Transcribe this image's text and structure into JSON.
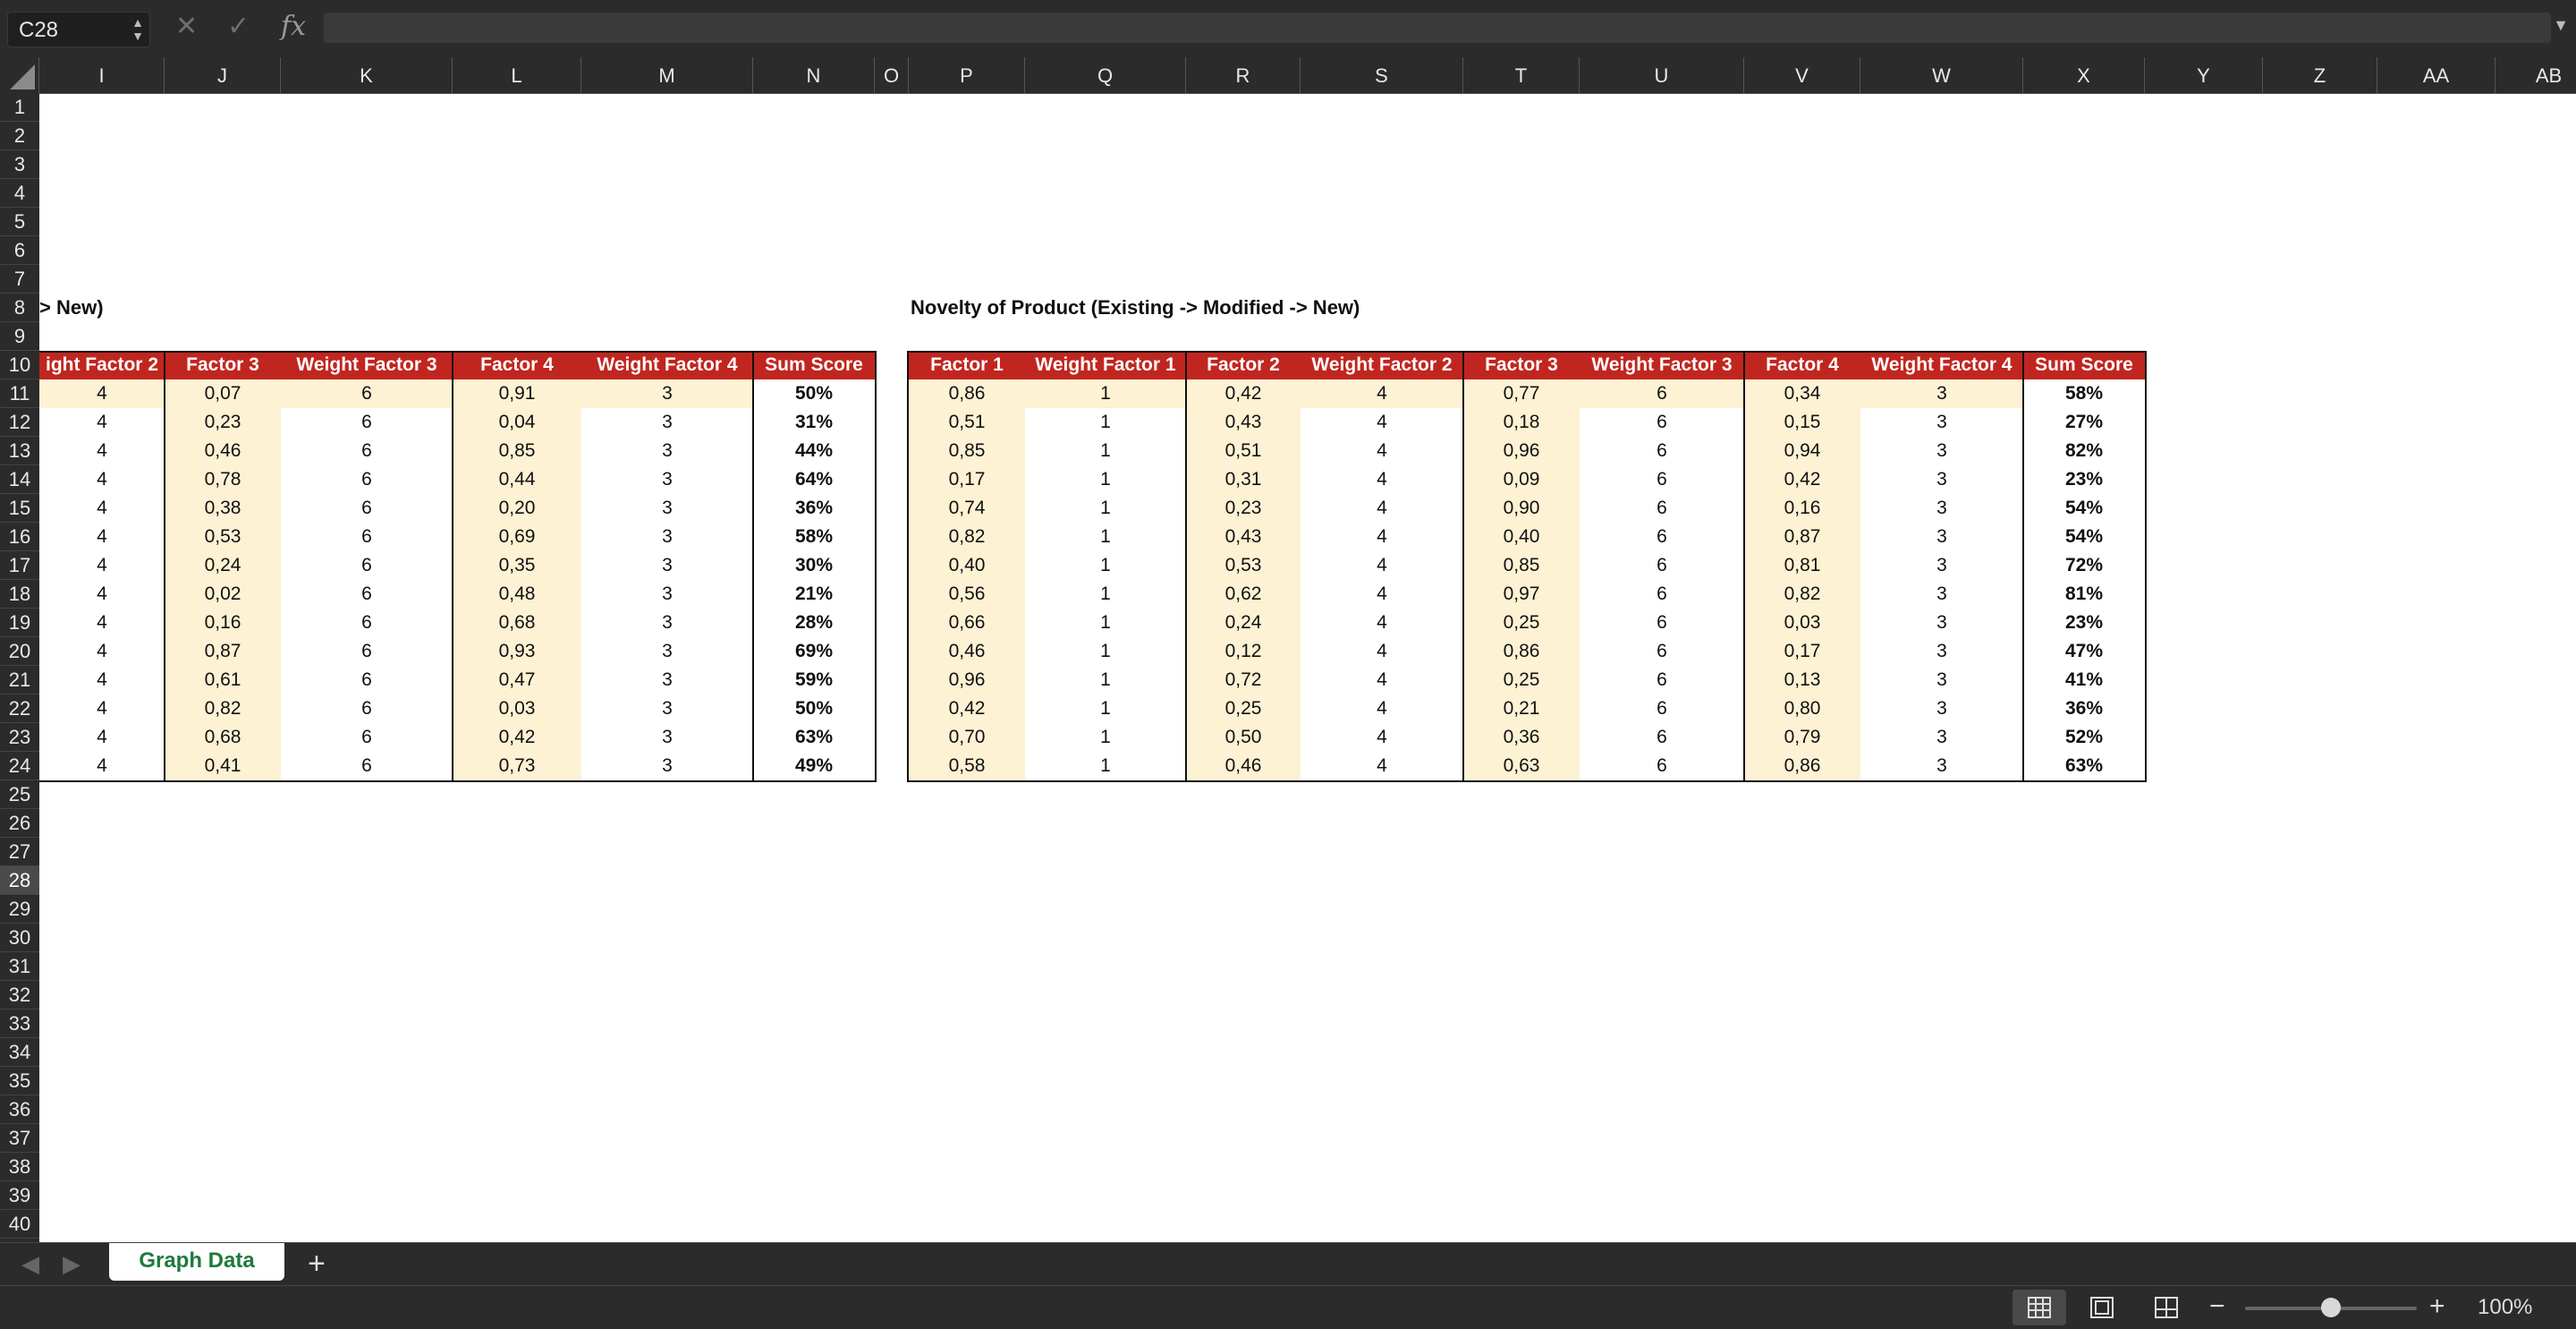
{
  "formula_bar": {
    "cell_ref": "C28",
    "formula": ""
  },
  "columns": [
    "I",
    "J",
    "K",
    "L",
    "M",
    "N",
    "O",
    "P",
    "Q",
    "R",
    "S",
    "T",
    "U",
    "V",
    "W",
    "X",
    "Y",
    "Z",
    "AA",
    "AB"
  ],
  "rows": [
    "1",
    "2",
    "3",
    "4",
    "5",
    "6",
    "7",
    "8",
    "9",
    "10",
    "11",
    "12",
    "13",
    "14",
    "15",
    "16",
    "17",
    "18",
    "19",
    "20",
    "21",
    "22",
    "23",
    "24",
    "25",
    "26",
    "27",
    "28",
    "29",
    "30",
    "31",
    "32",
    "33",
    "34",
    "35",
    "36",
    "37",
    "38",
    "39",
    "40"
  ],
  "selected_row": "28",
  "left_table": {
    "title": "> New)",
    "headers": [
      "ight Factor 2",
      "Factor 3",
      "Weight Factor 3",
      "Factor 4",
      "Weight Factor 4",
      "Sum Score"
    ],
    "rows": [
      [
        "4",
        "0,07",
        "6",
        "0,91",
        "3",
        "50%"
      ],
      [
        "4",
        "0,23",
        "6",
        "0,04",
        "3",
        "31%"
      ],
      [
        "4",
        "0,46",
        "6",
        "0,85",
        "3",
        "44%"
      ],
      [
        "4",
        "0,78",
        "6",
        "0,44",
        "3",
        "64%"
      ],
      [
        "4",
        "0,38",
        "6",
        "0,20",
        "3",
        "36%"
      ],
      [
        "4",
        "0,53",
        "6",
        "0,69",
        "3",
        "58%"
      ],
      [
        "4",
        "0,24",
        "6",
        "0,35",
        "3",
        "30%"
      ],
      [
        "4",
        "0,02",
        "6",
        "0,48",
        "3",
        "21%"
      ],
      [
        "4",
        "0,16",
        "6",
        "0,68",
        "3",
        "28%"
      ],
      [
        "4",
        "0,87",
        "6",
        "0,93",
        "3",
        "69%"
      ],
      [
        "4",
        "0,61",
        "6",
        "0,47",
        "3",
        "59%"
      ],
      [
        "4",
        "0,82",
        "6",
        "0,03",
        "3",
        "50%"
      ],
      [
        "4",
        "0,68",
        "6",
        "0,42",
        "3",
        "63%"
      ],
      [
        "4",
        "0,41",
        "6",
        "0,73",
        "3",
        "49%"
      ]
    ]
  },
  "right_table": {
    "title": "Novelty of Product (Existing -> Modified -> New)",
    "headers": [
      "Factor 1",
      "Weight Factor 1",
      "Factor 2",
      "Weight Factor 2",
      "Factor 3",
      "Weight Factor 3",
      "Factor 4",
      "Weight Factor 4",
      "Sum Score"
    ],
    "rows": [
      [
        "0,86",
        "1",
        "0,42",
        "4",
        "0,77",
        "6",
        "0,34",
        "3",
        "58%"
      ],
      [
        "0,51",
        "1",
        "0,43",
        "4",
        "0,18",
        "6",
        "0,15",
        "3",
        "27%"
      ],
      [
        "0,85",
        "1",
        "0,51",
        "4",
        "0,96",
        "6",
        "0,94",
        "3",
        "82%"
      ],
      [
        "0,17",
        "1",
        "0,31",
        "4",
        "0,09",
        "6",
        "0,42",
        "3",
        "23%"
      ],
      [
        "0,74",
        "1",
        "0,23",
        "4",
        "0,90",
        "6",
        "0,16",
        "3",
        "54%"
      ],
      [
        "0,82",
        "1",
        "0,43",
        "4",
        "0,40",
        "6",
        "0,87",
        "3",
        "54%"
      ],
      [
        "0,40",
        "1",
        "0,53",
        "4",
        "0,85",
        "6",
        "0,81",
        "3",
        "72%"
      ],
      [
        "0,56",
        "1",
        "0,62",
        "4",
        "0,97",
        "6",
        "0,82",
        "3",
        "81%"
      ],
      [
        "0,66",
        "1",
        "0,24",
        "4",
        "0,25",
        "6",
        "0,03",
        "3",
        "23%"
      ],
      [
        "0,46",
        "1",
        "0,12",
        "4",
        "0,86",
        "6",
        "0,17",
        "3",
        "47%"
      ],
      [
        "0,96",
        "1",
        "0,72",
        "4",
        "0,25",
        "6",
        "0,13",
        "3",
        "41%"
      ],
      [
        "0,42",
        "1",
        "0,25",
        "4",
        "0,21",
        "6",
        "0,80",
        "3",
        "36%"
      ],
      [
        "0,70",
        "1",
        "0,50",
        "4",
        "0,36",
        "6",
        "0,79",
        "3",
        "52%"
      ],
      [
        "0,58",
        "1",
        "0,46",
        "4",
        "0,63",
        "6",
        "0,86",
        "3",
        "63%"
      ]
    ]
  },
  "sheet_tabs": [
    "Graph Data"
  ],
  "status_bar": {
    "zoom": "100%",
    "zoom_fraction": 0.5
  },
  "colors": {
    "header_red": "#c0261f",
    "shade": "#fdf2d4",
    "tab_green": "#1e7a3c"
  }
}
